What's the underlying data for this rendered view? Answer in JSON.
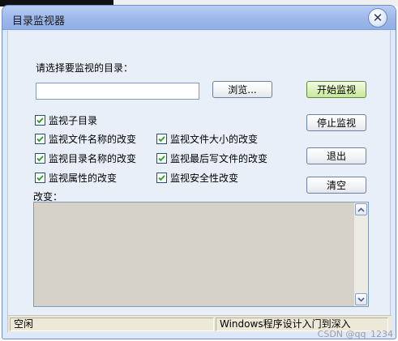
{
  "window": {
    "title": "目录监视器"
  },
  "icons": {
    "close": "close-icon",
    "scroll_up": "chevron-up-icon",
    "scroll_down": "chevron-down-icon",
    "check": "check-icon"
  },
  "colors": {
    "titlebar": "#9db8ea",
    "client_bg": "#e9eff9",
    "start_button": "#d9f0b5",
    "output_bg": "#d6d2c9",
    "statusbar": "#ece9d8"
  },
  "form": {
    "prompt": "请选择要监视的目录：",
    "path_value": "",
    "path_placeholder": "",
    "browse_label": "浏览...",
    "change_label": "改变："
  },
  "buttons": {
    "start": "开始监视",
    "stop": "停止监视",
    "exit": "退出",
    "clear": "清空"
  },
  "options": [
    {
      "label": "监视子目录",
      "checked": true
    },
    {
      "label": "监视文件名称的改变",
      "checked": true
    },
    {
      "label": "监视文件大小的改变",
      "checked": true
    },
    {
      "label": "监视目录名称的改变",
      "checked": true
    },
    {
      "label": "监视最后写文件的改变",
      "checked": true
    },
    {
      "label": "监视属性的改变",
      "checked": true
    },
    {
      "label": "监视安全性改变",
      "checked": true
    }
  ],
  "status": {
    "left": "空闲",
    "right": "Windows程序设计入门到深入"
  },
  "watermark": "CSDN @qq_1234"
}
